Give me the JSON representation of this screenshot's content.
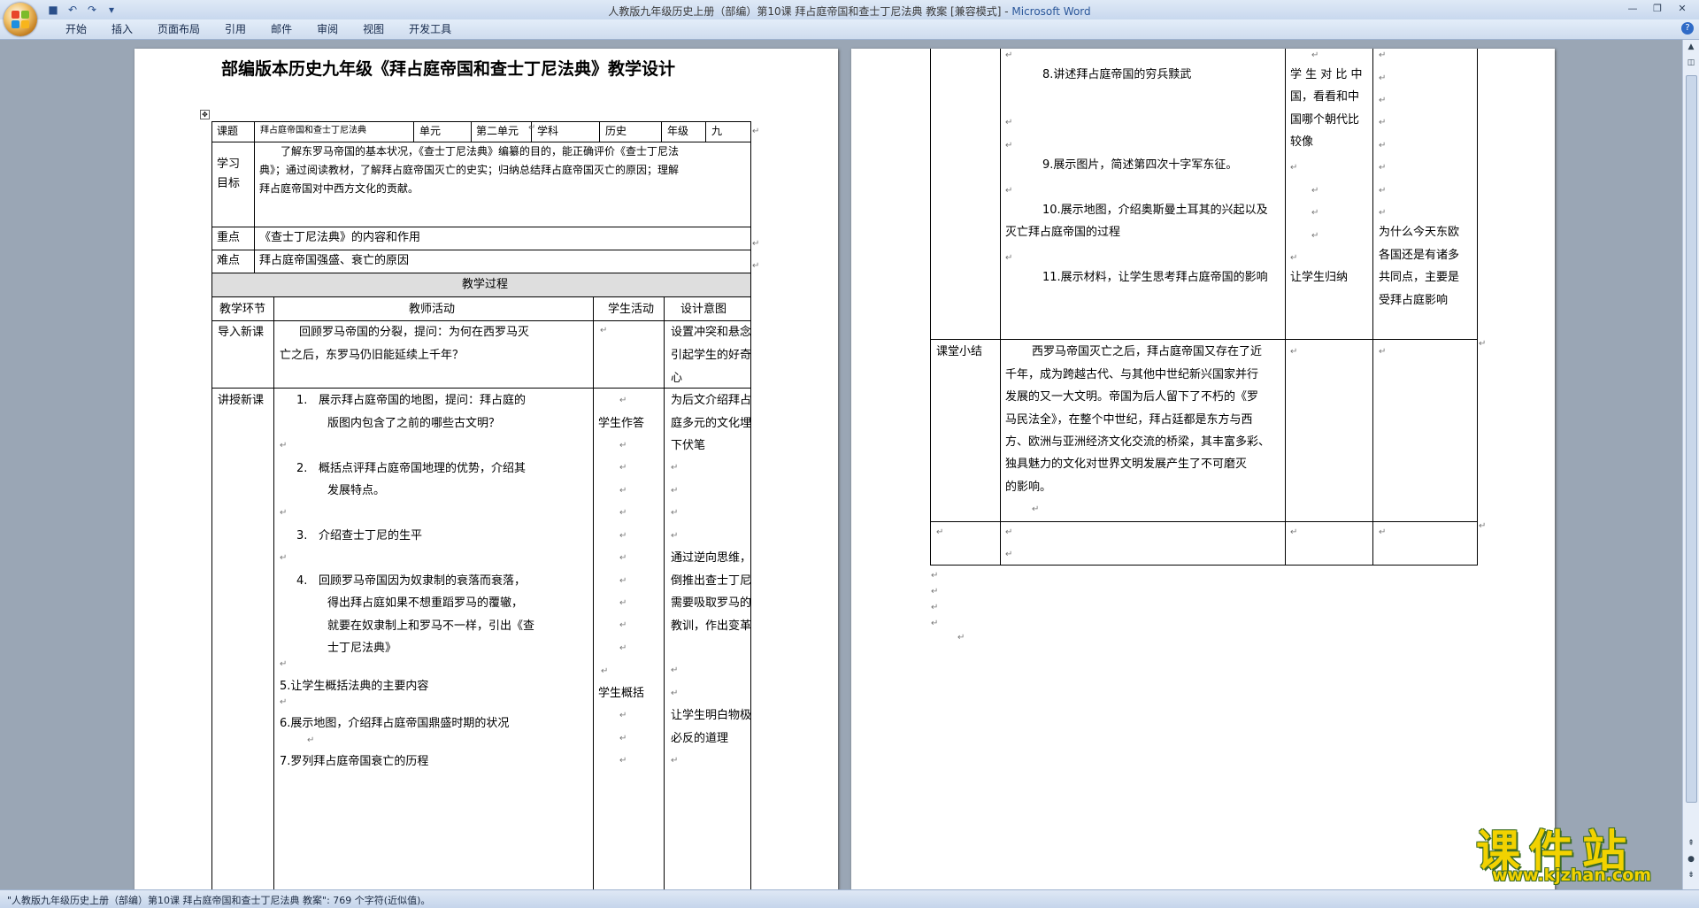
{
  "window": {
    "title": "人教版九年级历史上册（部编）第10课 拜占庭帝国和查士丁尼法典 教案 [兼容模式] - ",
    "app": "Microsoft Word"
  },
  "ribbon": {
    "tabs": [
      "开始",
      "插入",
      "页面布局",
      "引用",
      "邮件",
      "审阅",
      "视图",
      "开发工具"
    ]
  },
  "doc": {
    "title": "部编版本历史九年级《拜占庭帝国和查士丁尼法典》教学设计",
    "info": {
      "课题_label": "课题",
      "课题": "拜占庭帝国和查士丁尼法典",
      "单元_label": "单元",
      "单元": "第二单元",
      "学科_label": "学科",
      "学科": "历史",
      "年级_label": "年级",
      "年级": "九"
    },
    "goals_label": [
      "学习",
      "目标"
    ],
    "goals": [
      "了解东罗马帝国的基本状况，《查士丁尼法典》编纂的目的，能正确评价《查士丁尼法",
      "典》；通过阅读教材，了解拜占庭帝国灭亡的史实；归纳总结拜占庭帝国灭亡的原因；理解",
      "拜占庭帝国对中西方文化的贡献。"
    ],
    "key_label": "重点",
    "key": "《查士丁尼法典》的内容和作用",
    "diff_label": "难点",
    "diff": "拜占庭帝国强盛、衰亡的原因",
    "process_header": "教学过程",
    "cols": [
      "教学环节",
      "教师活动",
      "学生活动",
      "设计意图"
    ],
    "intro": {
      "stage": "导入新课",
      "teacher": [
        "回顾罗马帝国的分裂，提问：为何在西罗马灭",
        "亡之后，东罗马仍旧能延续上千年？"
      ],
      "intent": [
        "设置冲突和悬念",
        "引起学生的好奇",
        "心"
      ]
    },
    "lecture": {
      "stage": "讲授新课",
      "t1": [
        "1.",
        "展示拜占庭帝国的地图，提问：拜占庭的",
        "版图内包含了之前的哪些古文明？"
      ],
      "t2": [
        "2.",
        "概括点评拜占庭帝国地理的优势，介绍其",
        "发展特点。"
      ],
      "t3": [
        "3.",
        "介绍查士丁尼的生平"
      ],
      "t4": [
        "4.",
        "回顾罗马帝国因为奴隶制的衰落而衰落，",
        "得出拜占庭如果不想重蹈罗马的覆辙，",
        "就要在奴隶制上和罗马不一样，引出《查",
        "士丁尼法典》"
      ],
      "t5": "5.让学生概括法典的主要内容",
      "t6": "6.展示地图，介绍拜占庭帝国鼎盛时期的状况",
      "t7": "7.罗列拜占庭帝国衰亡的历程",
      "s1": "学生作答",
      "s2": "学生概括",
      "i1": [
        "为后文介绍拜占",
        "庭多元的文化埋",
        "下伏笔"
      ],
      "i2": [
        "通过逆向思维，",
        "倒推出查士丁尼",
        "需要吸取罗马的",
        "教训，作出变革"
      ],
      "i3": [
        "让学生明白物极",
        "必反的道理"
      ]
    },
    "p2": {
      "t8": "8.讲述拜占庭帝国的穷兵黩武",
      "t9": "9.展示图片，简述第四次十字军东征。",
      "t10": [
        "10.展示地图，介绍奥斯曼土耳其的兴起以及",
        "灭亡拜占庭帝国的过程"
      ],
      "t11": "11.展示材料，让学生思考拜占庭帝国的影响",
      "s8": [
        "学 生 对 比 中",
        "国，看看和中",
        "国哪个朝代比",
        "较像"
      ],
      "s11": "让学生归纳",
      "i11": [
        "为什么今天东欧",
        "各国还是有诸多",
        "共同点，主要是",
        "受拜占庭影响"
      ],
      "summary_label": "课堂小结",
      "summary": [
        "西罗马帝国灭亡之后，拜占庭帝国又存在了近",
        "千年，成为跨越古代、与其他中世纪新兴国家并行",
        "发展的又一大文明。帝国为后人留下了不朽的《罗",
        "马民法全》，在整个中世纪，拜占廷都是东方与西",
        "方、欧洲与亚洲经济文化交流的桥梁，其丰富多彩、",
        "独具魅力的文化对世界文明发展产生了不可磨灭",
        "的影响。"
      ]
    }
  },
  "status": "\"人教版九年级历史上册（部编）第10课 拜占庭帝国和查士丁尼法典 教案\": 769 个字符(近似值)。",
  "watermark": {
    "main": "课件站",
    "sub": "www.kjzhan.com"
  },
  "marks": {
    "ret": "↵"
  }
}
